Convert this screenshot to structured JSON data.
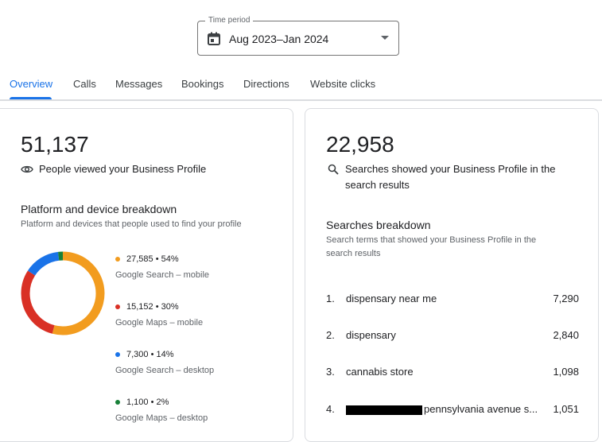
{
  "time_period": {
    "label": "Time period",
    "value": "Aug 2023–Jan 2024"
  },
  "tabs": [
    {
      "label": "Overview",
      "active": true
    },
    {
      "label": "Calls"
    },
    {
      "label": "Messages"
    },
    {
      "label": "Bookings"
    },
    {
      "label": "Directions"
    },
    {
      "label": "Website clicks"
    }
  ],
  "profile_views": {
    "count": "51,137",
    "description": "People viewed your Business Profile",
    "icon": "eye-icon"
  },
  "platform_breakdown": {
    "title": "Platform and device breakdown",
    "subtitle": "Platform and devices that people used to find your profile",
    "items": [
      {
        "value_text": "27,585 • 54%",
        "name": "Google Search – mobile",
        "percent": 54,
        "color": "#f29c1f"
      },
      {
        "value_text": "15,152 • 30%",
        "name": "Google Maps – mobile",
        "percent": 30,
        "color": "#d93025"
      },
      {
        "value_text": "7,300 • 14%",
        "name": "Google Search – desktop",
        "percent": 14,
        "color": "#1a73e8"
      },
      {
        "value_text": "1,100 • 2%",
        "name": "Google Maps – desktop",
        "percent": 2,
        "color": "#188038"
      }
    ]
  },
  "searches": {
    "count": "22,958",
    "description_line1": "Searches showed your Business Profile in the",
    "description_line2": "search results",
    "icon": "search-icon"
  },
  "searches_breakdown": {
    "title": "Searches breakdown",
    "subtitle_line1": "Search terms that showed your Business Profile in the",
    "subtitle_line2": "search results",
    "items": [
      {
        "rank": "1.",
        "term": "dispensary near me",
        "count": "7,290"
      },
      {
        "rank": "2.",
        "term": "dispensary",
        "count": "2,840"
      },
      {
        "rank": "3.",
        "term": "cannabis store",
        "count": "1,098"
      },
      {
        "rank": "4.",
        "term": "pennsylvania avenue s...",
        "count": "1,051",
        "redacted_prefix": true
      }
    ]
  }
}
